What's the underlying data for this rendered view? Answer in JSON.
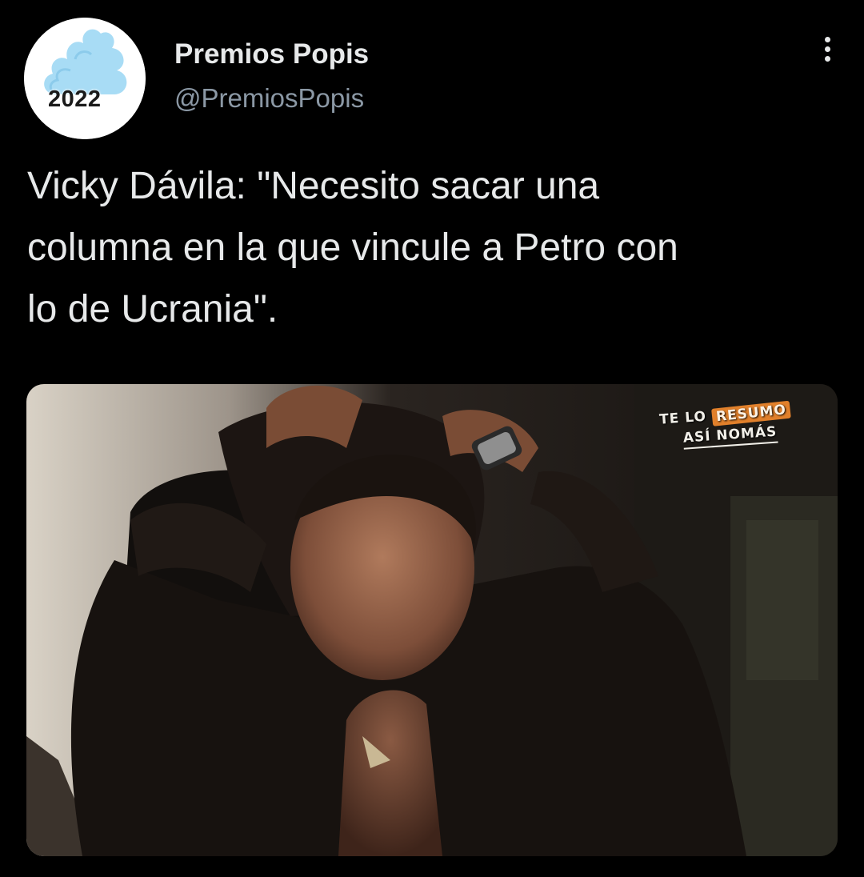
{
  "profile": {
    "display_name": "Premios Popis",
    "handle": "@PremiosPopis",
    "avatar_year": "2022",
    "avatar_icon": "cloud-swirl-logo-icon"
  },
  "menu": {
    "icon": "more-vertical-icon"
  },
  "tweet": {
    "text": "Vicky Dávila: \"Necesito sacar una\ncolumna en la que vincule a Petro con\nlo de Ucrania\"."
  },
  "media": {
    "watermark": {
      "line1_prefix": "TE LO",
      "line1_highlight": "RESUMO",
      "line2": "ASÍ NOMÁS"
    }
  },
  "colors": {
    "background": "#000000",
    "text_primary": "#e7e9ea",
    "text_secondary": "#8b98a5",
    "avatar_blue": "#a8dcf5",
    "watermark_orange": "#e1802b"
  }
}
